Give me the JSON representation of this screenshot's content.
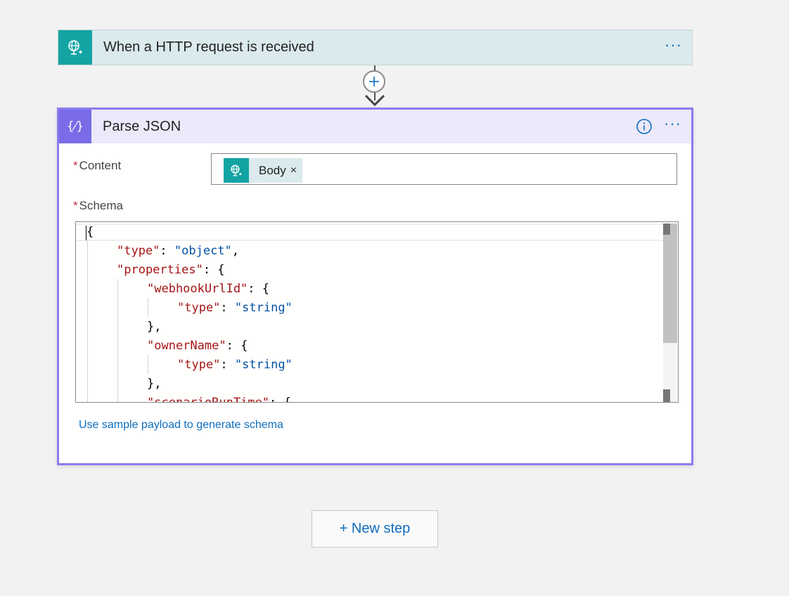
{
  "trigger": {
    "title": "When a HTTP request is received",
    "icon": "globe-request-icon",
    "more": "···"
  },
  "connector": {
    "add_icon": "plus-icon"
  },
  "parse_json": {
    "title": "Parse JSON",
    "icon_glyph": "{⁄}",
    "more": "···",
    "content_label": "Content",
    "schema_label": "Schema",
    "required_marker": "*",
    "content_token": {
      "label": "Body",
      "remove": "×",
      "icon": "globe-request-icon"
    },
    "schema_lines": [
      {
        "indent": 0,
        "parts": [
          {
            "t": "p",
            "v": "{"
          }
        ]
      },
      {
        "indent": 1,
        "parts": [
          {
            "t": "k",
            "v": "\"type\""
          },
          {
            "t": "p",
            "v": ": "
          },
          {
            "t": "s",
            "v": "\"object\""
          },
          {
            "t": "p",
            "v": ","
          }
        ]
      },
      {
        "indent": 1,
        "parts": [
          {
            "t": "k",
            "v": "\"properties\""
          },
          {
            "t": "p",
            "v": ": {"
          }
        ]
      },
      {
        "indent": 2,
        "parts": [
          {
            "t": "k",
            "v": "\"webhookUrlId\""
          },
          {
            "t": "p",
            "v": ": {"
          }
        ]
      },
      {
        "indent": 3,
        "parts": [
          {
            "t": "k",
            "v": "\"type\""
          },
          {
            "t": "p",
            "v": ": "
          },
          {
            "t": "s",
            "v": "\"string\""
          }
        ]
      },
      {
        "indent": 2,
        "parts": [
          {
            "t": "p",
            "v": "},"
          }
        ]
      },
      {
        "indent": 2,
        "parts": [
          {
            "t": "k",
            "v": "\"ownerName\""
          },
          {
            "t": "p",
            "v": ": {"
          }
        ]
      },
      {
        "indent": 3,
        "parts": [
          {
            "t": "k",
            "v": "\"type\""
          },
          {
            "t": "p",
            "v": ": "
          },
          {
            "t": "s",
            "v": "\"string\""
          }
        ]
      },
      {
        "indent": 2,
        "parts": [
          {
            "t": "p",
            "v": "},"
          }
        ]
      },
      {
        "indent": 2,
        "parts": [
          {
            "t": "k",
            "v": "\"scenarioRunTime\""
          },
          {
            "t": "p",
            "v": ": {"
          }
        ]
      }
    ],
    "sample_link": "Use sample payload to generate schema"
  },
  "new_step": {
    "label": "+ New step"
  },
  "colors": {
    "trigger_accent": "#13a3a3",
    "parse_accent": "#7a6be6",
    "link": "#0f6cbd",
    "json_key": "#a31515",
    "json_string": "#0451a5"
  }
}
